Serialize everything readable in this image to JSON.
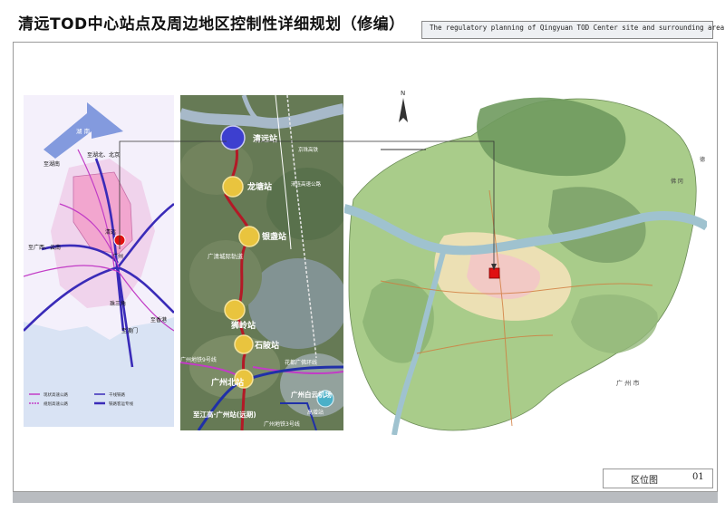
{
  "header": {
    "title": "清远TOD中心站点及周边地区控制性详细规划（修编）",
    "subtitle": "The regulatory planning of Qingyuan TOD Center site and surrounding area"
  },
  "regional_map": {
    "labels": {
      "north_arrow": "湖 南",
      "to_hunan": "至湖南",
      "to_jiangxi_beijing": "至湖北、北京",
      "to_guangxi_yunnan": "至广西、云南",
      "qingyuan": "清远",
      "guangzhou": "广州",
      "prd": "珠三角",
      "shenzhen_hk": "至香港",
      "macau": "至澳门"
    },
    "legend": [
      "现状高速公路",
      "规划高速公路",
      "干线铁路",
      "铁路客运专线"
    ],
    "colors": {
      "rail": "#3a2bb8",
      "highway": "#c23cc6",
      "hub": "#e01010",
      "region": "#f2a6cf"
    }
  },
  "rail_map": {
    "stations": [
      {
        "name": "清远站",
        "color": "#3d3fcf"
      },
      {
        "name": "龙塘站",
        "color": "#e9c43e"
      },
      {
        "name": "银盏站",
        "color": "#e9c43e"
      },
      {
        "name": "狮岭站",
        "color": "#e9c43e"
      },
      {
        "name": "石陂站",
        "color": "#e9c43e"
      },
      {
        "name": "广州北站",
        "color": "#e9c43e"
      }
    ],
    "labels": {
      "line_name": "广清城际轨道",
      "airport_line": "广州地铁9号线",
      "metro3": "广州地铁3号线",
      "airport": "广州白云机场",
      "gz_station": "至江高·广州站(远期)",
      "gaozeng": "高增站",
      "yuanjiang": "花都广佛环线",
      "expressway": "清连高速公路",
      "xinghua": "京珠高铁"
    }
  },
  "district_map": {
    "labels": {
      "guangzhou_city": "广 州 市",
      "north": "N",
      "fogang": "佛 冈",
      "de": "德"
    }
  },
  "caption": {
    "label": "区位图",
    "page": "01"
  }
}
